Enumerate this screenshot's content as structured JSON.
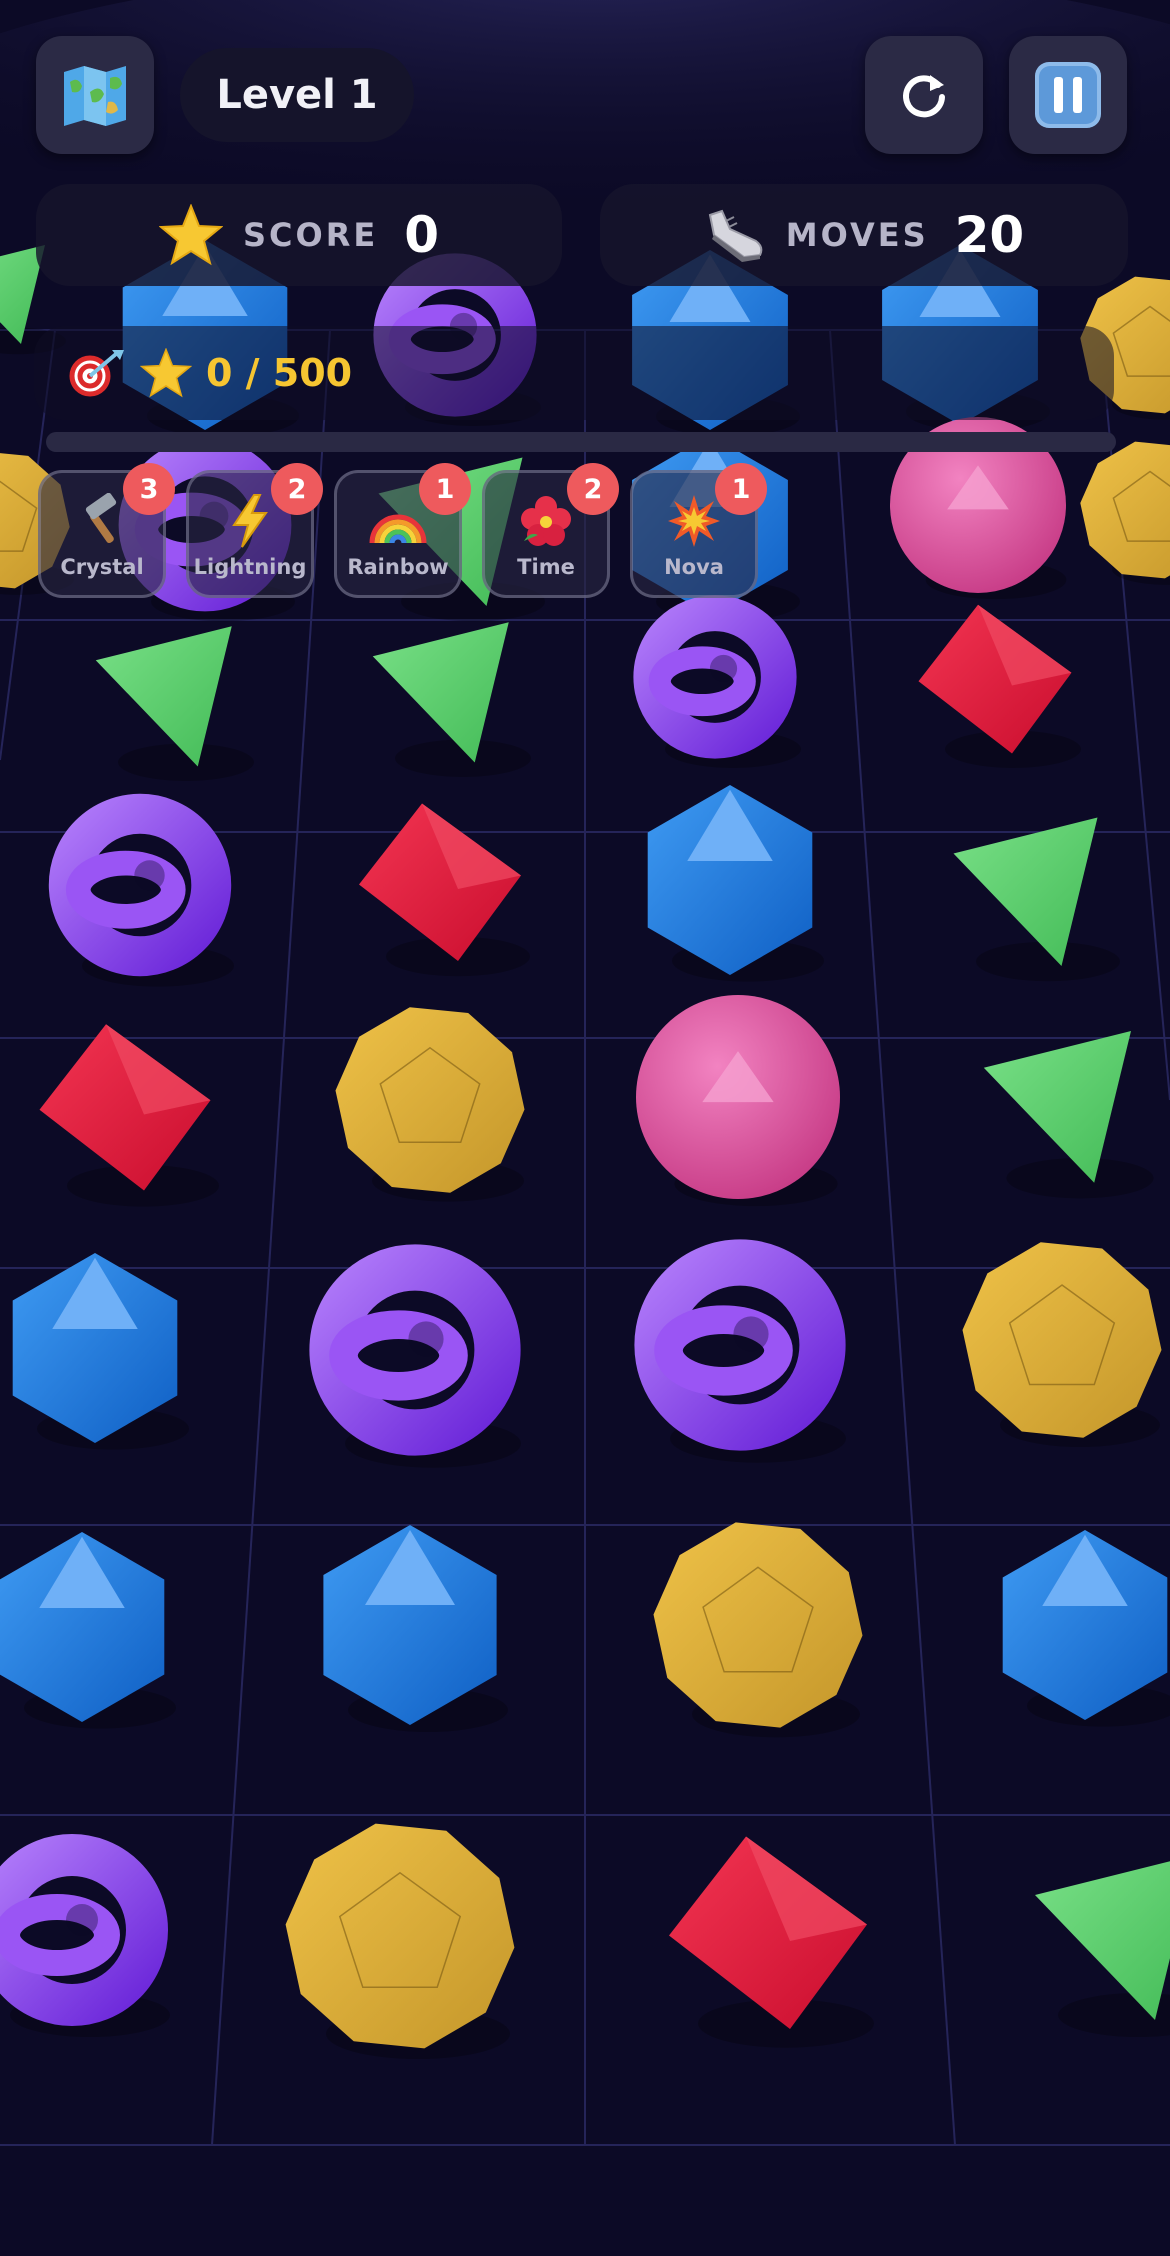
{
  "header": {
    "level_label": "Level 1"
  },
  "stats": {
    "score_label": "SCORE",
    "score_value": "0",
    "moves_label": "MOVES",
    "moves_value": "20"
  },
  "goal": {
    "text": "0 / 500",
    "progress": 0
  },
  "powerups": [
    {
      "label": "Crystal",
      "count": "3",
      "icon": "hammer-icon"
    },
    {
      "label": "Lightning",
      "count": "2",
      "icon": "lightning-icon"
    },
    {
      "label": "Rainbow",
      "count": "1",
      "icon": "rainbow-icon"
    },
    {
      "label": "Time",
      "count": "2",
      "icon": "hibiscus-icon"
    },
    {
      "label": "Nova",
      "count": "1",
      "icon": "explosion-icon"
    }
  ],
  "colors": {
    "background": "#0c0a26",
    "accent_gold": "#f6c531",
    "badge_red": "#ee5a5d",
    "gem_blue": "#1d7fe0",
    "gem_purple": "#8b3ff0",
    "gem_green": "#5ecf6f",
    "gem_red": "#e3183c",
    "gem_yellow": "#dfaf36",
    "gem_pink": "#e0529f"
  },
  "board": {
    "gems": [
      {
        "type": "green-tetra"
      },
      {
        "type": "blue-icosa"
      },
      {
        "type": "purple-knot"
      },
      {
        "type": "blue-icosa"
      },
      {
        "type": "blue-icosa"
      },
      {
        "type": "yellow-dodeca"
      },
      {
        "type": "yellow-dodeca"
      },
      {
        "type": "purple-knot"
      },
      {
        "type": "green-tetra"
      },
      {
        "type": "blue-icosa"
      },
      {
        "type": "pink-sphere"
      },
      {
        "type": "yellow-dodeca"
      },
      {
        "type": "green-tetra"
      },
      {
        "type": "green-tetra"
      },
      {
        "type": "purple-knot"
      },
      {
        "type": "red-octa"
      },
      {
        "type": "purple-knot"
      },
      {
        "type": "red-octa"
      },
      {
        "type": "blue-icosa"
      },
      {
        "type": "green-tetra"
      },
      {
        "type": "red-octa"
      },
      {
        "type": "yellow-dodeca"
      },
      {
        "type": "pink-sphere"
      },
      {
        "type": "green-tetra"
      },
      {
        "type": "blue-icosa"
      },
      {
        "type": "purple-knot"
      },
      {
        "type": "purple-knot"
      },
      {
        "type": "yellow-dodeca"
      },
      {
        "type": "blue-icosa"
      },
      {
        "type": "blue-icosa"
      },
      {
        "type": "yellow-dodeca"
      },
      {
        "type": "blue-icosa"
      },
      {
        "type": "purple-knot"
      },
      {
        "type": "yellow-dodeca"
      },
      {
        "type": "red-octa"
      },
      {
        "type": "green-tetra"
      }
    ]
  }
}
